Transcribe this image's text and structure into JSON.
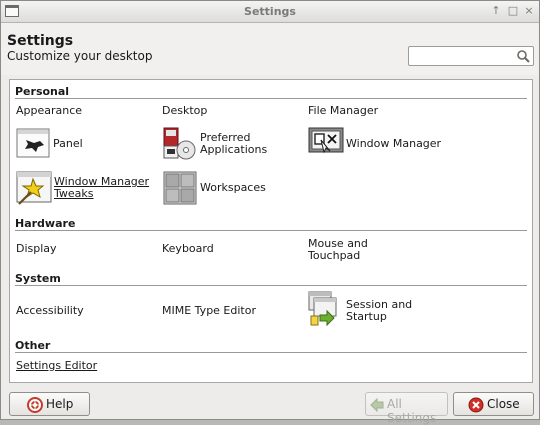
{
  "window": {
    "title": "Settings"
  },
  "header": {
    "title": "Settings",
    "subtitle": "Customize your desktop"
  },
  "search": {
    "value": "",
    "placeholder": ""
  },
  "sections": {
    "personal": {
      "title": "Personal",
      "items": {
        "appearance": "Appearance",
        "desktop": "Desktop",
        "file_manager": "File Manager",
        "panel": "Panel",
        "preferred_line1": "Preferred",
        "preferred_line2": "Applications",
        "window_manager": "Window Manager",
        "wm_tweaks_line1": "Window Manager",
        "wm_tweaks_line2": "Tweaks",
        "workspaces": "Workspaces"
      }
    },
    "hardware": {
      "title": "Hardware",
      "items": {
        "display": "Display",
        "keyboard": "Keyboard",
        "mouse_line1": "Mouse and",
        "mouse_line2": "Touchpad"
      }
    },
    "system": {
      "title": "System",
      "items": {
        "accessibility": "Accessibility",
        "mime": "MIME Type Editor",
        "session_line1": "Session and",
        "session_line2": "Startup"
      }
    },
    "other": {
      "title": "Other",
      "items": {
        "settings_editor": "Settings Editor"
      }
    }
  },
  "footer": {
    "help": "Help",
    "all_settings": "All Settings",
    "close": "Close"
  }
}
